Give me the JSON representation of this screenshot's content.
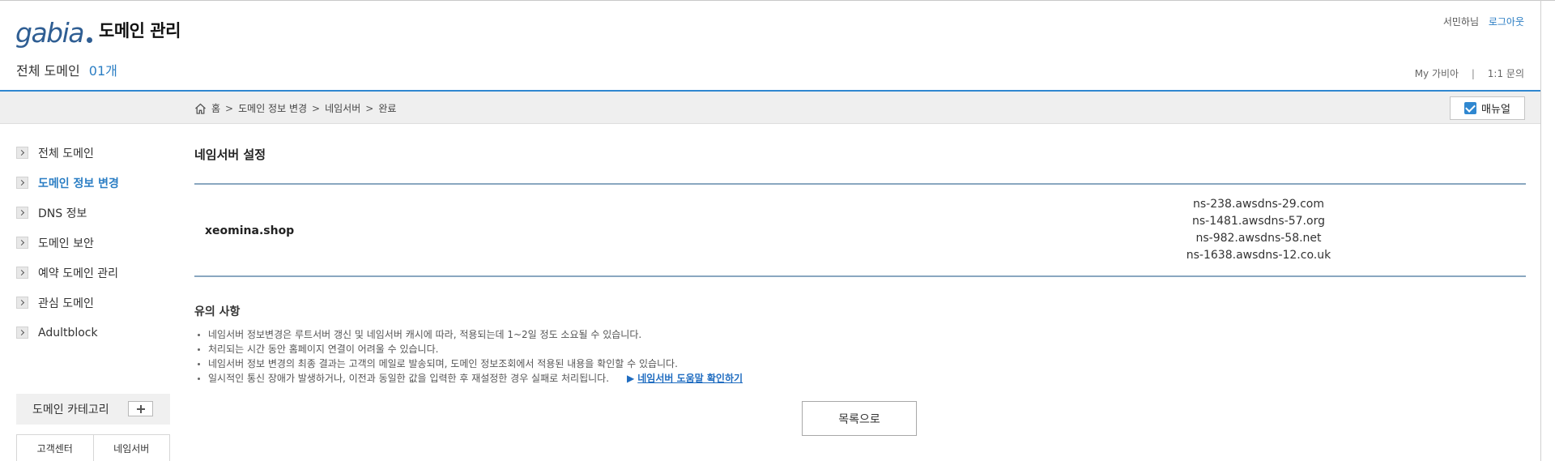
{
  "header": {
    "logo_text": "gabia",
    "app_title": "도메인 관리",
    "domain_count_label": "전체 도메인",
    "domain_count_value": "01개",
    "user_name": "서민하님",
    "logout_label": "로그아웃",
    "my_gabia_label": "My 가비아",
    "separator": "|",
    "inquiry_label": "1:1 문의"
  },
  "breadcrumb": {
    "items": [
      "홈",
      "도메인 정보 변경",
      "네임서버",
      "완료"
    ],
    "arrow": ">"
  },
  "manual_button": {
    "label": "매뉴얼"
  },
  "sidebar": {
    "items": [
      {
        "label": "전체 도메인",
        "active": false
      },
      {
        "label": "도메인 정보 변경",
        "active": true
      },
      {
        "label": "DNS 정보",
        "active": false
      },
      {
        "label": "도메인 보안",
        "active": false
      },
      {
        "label": "예약 도메인 관리",
        "active": false
      },
      {
        "label": "관심 도메인",
        "active": false
      },
      {
        "label": "Adultblock",
        "active": false
      }
    ],
    "category_label": "도메인 카테고리",
    "tabs": [
      "고객센터",
      "네임서버"
    ]
  },
  "main": {
    "section_title": "네임서버 설정",
    "domain": "xeomina.shop",
    "nameservers": [
      "ns-238.awsdns-29.com",
      "ns-1481.awsdns-57.org",
      "ns-982.awsdns-58.net",
      "ns-1638.awsdns-12.co.uk"
    ],
    "notice_title": "유의 사항",
    "notices": [
      "네임서버 정보변경은 루트서버 갱신 및 네임서버 캐시에 따라, 적용되는데 1~2일 정도 소요될 수 있습니다.",
      "처리되는 시간 동안 홈페이지 연결이 어려울 수 있습니다.",
      "네임서버 정보 변경의 최종 결과는 고객의 메일로 발송되며, 도메인 정보조회에서 적용된 내용을 확인할 수 있습니다.",
      "일시적인 통신 장애가 발생하거나, 이전과 동일한 값을 입력한 후 재설정한 경우 실패로 처리됩니다."
    ],
    "help_link_label": "네임서버 도움말 확인하기",
    "list_button_label": "목록으로"
  },
  "colors": {
    "accent": "#2b7ec4",
    "header_line": "#2f87d0",
    "logo": "#2f5e93",
    "rule": "#8aa7c0"
  }
}
